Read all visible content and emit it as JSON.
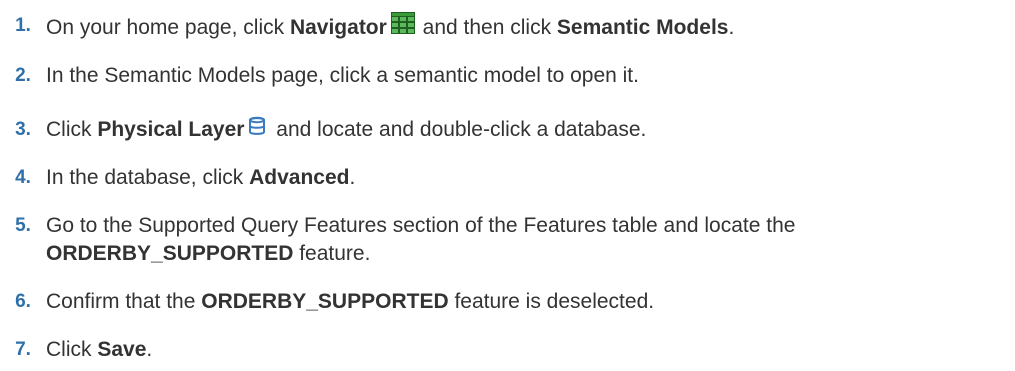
{
  "steps": [
    {
      "number": "1.",
      "parts": [
        "On your home page, click ",
        "Navigator",
        "and then click ",
        "Semantic Models",
        "."
      ],
      "icon": "grid-icon"
    },
    {
      "number": "2.",
      "text": "In the Semantic Models page, click a semantic model to open it."
    },
    {
      "number": "3.",
      "parts": [
        "Click ",
        "Physical Layer",
        "and locate and double-click a database."
      ],
      "icon": "database-icon"
    },
    {
      "number": "4.",
      "parts": [
        "In the database, click ",
        "Advanced",
        "."
      ]
    },
    {
      "number": "5.",
      "parts": [
        "Go to the Supported Query Features section of the Features table and locate the ",
        "ORDERBY_SUPPORTED",
        " feature."
      ]
    },
    {
      "number": "6.",
      "parts": [
        "Confirm that the ",
        "ORDERBY_SUPPORTED",
        " feature is deselected."
      ]
    },
    {
      "number": "7.",
      "parts": [
        "Click ",
        "Save",
        "."
      ]
    }
  ],
  "colors": {
    "step_number": "#2f70a8",
    "text": "#333333",
    "grid_icon_fill": "#2e8b2e",
    "db_icon_stroke": "#3a7bbf"
  }
}
